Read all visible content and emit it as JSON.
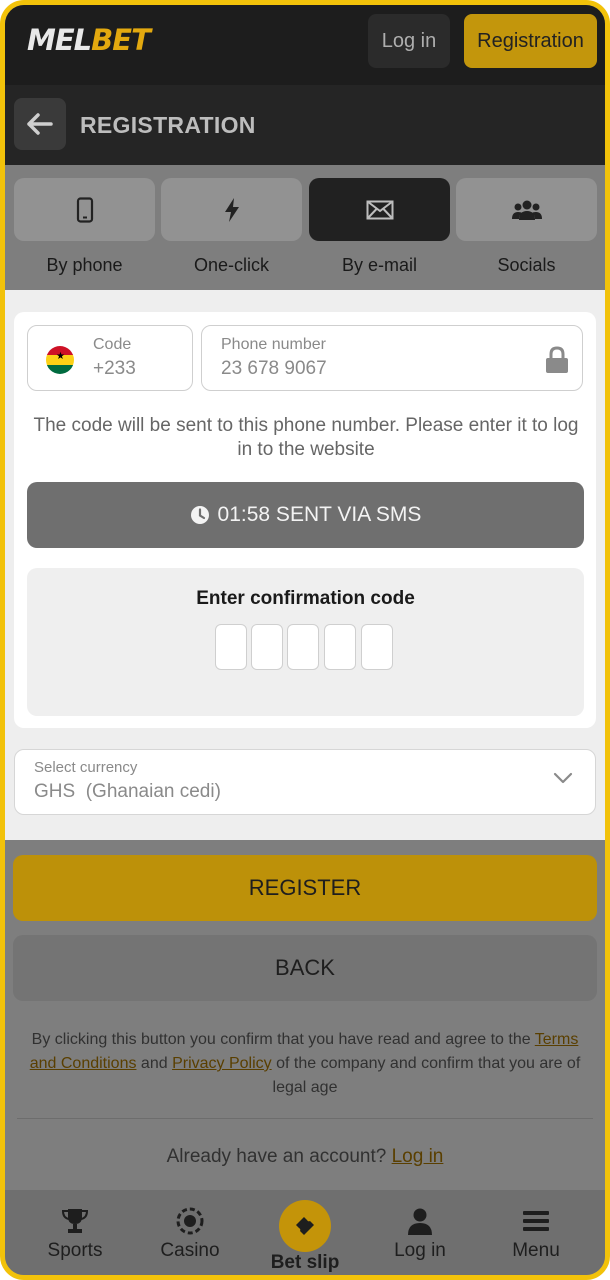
{
  "header": {
    "logo_left": "MEL",
    "logo_right": "BET",
    "login_label": "Log in",
    "register_label": "Registration"
  },
  "titlebar": {
    "title": "REGISTRATION"
  },
  "tabs": [
    {
      "label": "By phone",
      "icon": "phone-icon",
      "active": false
    },
    {
      "label": "One-click",
      "icon": "lightning-icon",
      "active": false
    },
    {
      "label": "By e-mail",
      "icon": "envelope-icon",
      "active": true
    },
    {
      "label": "Socials",
      "icon": "people-icon",
      "active": false
    }
  ],
  "form": {
    "code_label": "Code",
    "code_value": "+233",
    "phone_label": "Phone number",
    "phone_value": "23 678 9067",
    "note": "The code will be sent to this phone number. Please enter it to log in to the website",
    "sms_status": "01:58 SENT VIA SMS",
    "confirm_title": "Enter confirmation code",
    "currency_label": "Select currency",
    "currency_value": "GHS  (Ghanaian cedi)"
  },
  "actions": {
    "register_label": "REGISTER",
    "back_label": "BACK"
  },
  "legal": {
    "part1": "By clicking this button you confirm that you have read and agree to the ",
    "terms": "Terms and Conditions",
    "part2": " and ",
    "privacy": "Privacy Policy",
    "part3": " of the company and confirm that you are of legal age"
  },
  "account": {
    "text": "Already have an account? ",
    "link": "Log in"
  },
  "bottomnav": {
    "sports": "Sports",
    "casino": "Casino",
    "betslip": "Bet slip",
    "login": "Log in",
    "menu": "Menu"
  },
  "colors": {
    "accent": "#f2c20a",
    "brand_yellow": "#e3a90f"
  }
}
